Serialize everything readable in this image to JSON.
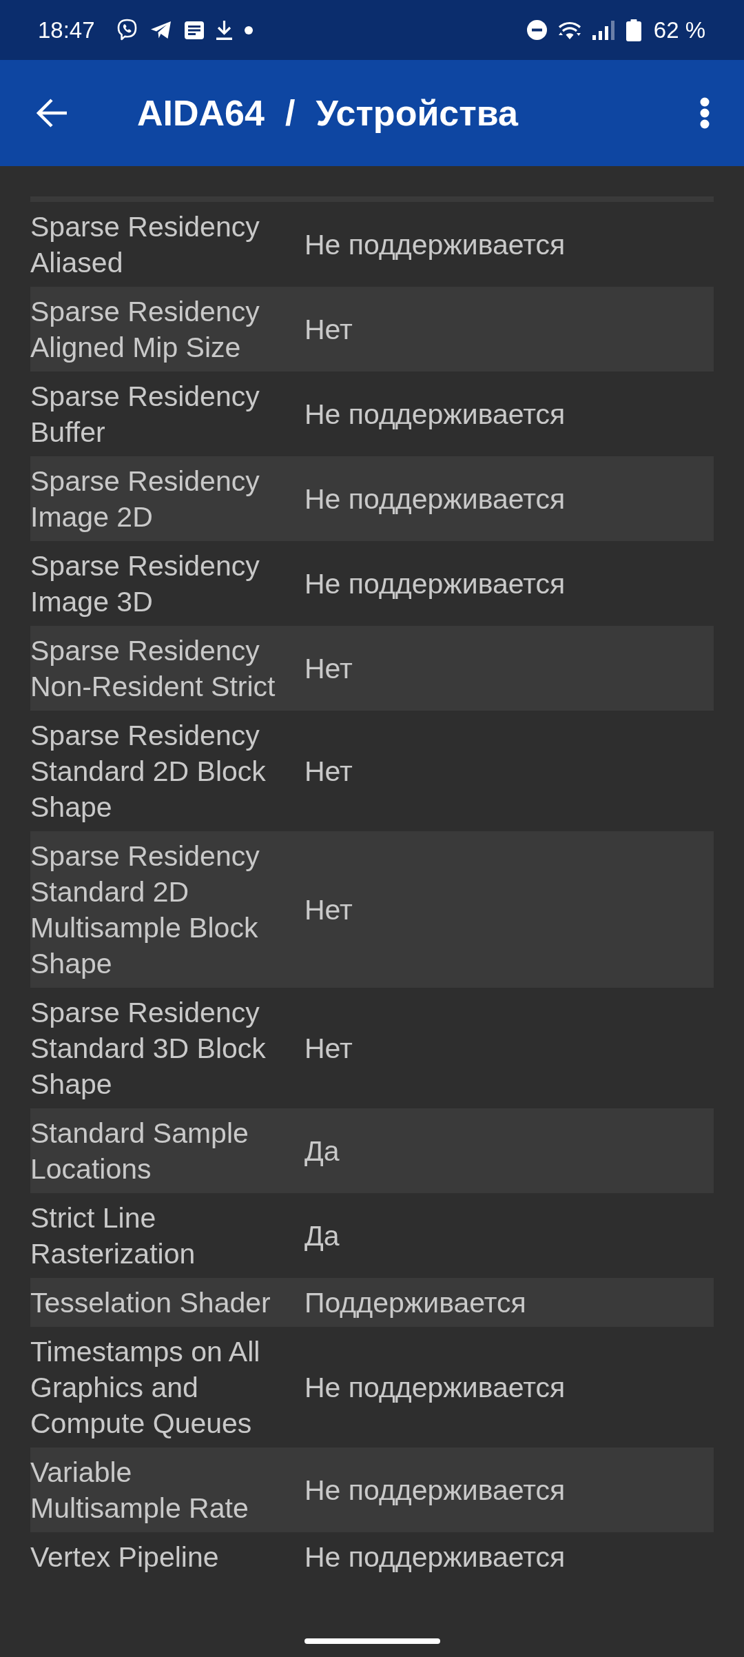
{
  "status_bar": {
    "time": "18:47",
    "battery": "62 %"
  },
  "app_bar": {
    "app": "AIDA64",
    "separator": "/",
    "section": "Устройства"
  },
  "rows": [
    {
      "label": "Sparse Residency Aliased",
      "value": "Не поддерживается"
    },
    {
      "label": "Sparse Residency Aligned Mip Size",
      "value": "Нет"
    },
    {
      "label": "Sparse Residency Buffer",
      "value": "Не поддерживается"
    },
    {
      "label": "Sparse Residency Image 2D",
      "value": "Не поддерживается"
    },
    {
      "label": "Sparse Residency Image 3D",
      "value": "Не поддерживается"
    },
    {
      "label": "Sparse Residency Non-Resident Strict",
      "value": "Нет"
    },
    {
      "label": "Sparse Residency Standard 2D Block Shape",
      "value": "Нет"
    },
    {
      "label": "Sparse Residency Standard 2D Multisample Block Shape",
      "value": "Нет"
    },
    {
      "label": "Sparse Residency Standard 3D Block Shape",
      "value": "Нет"
    },
    {
      "label": "Standard Sample Locations",
      "value": "Да"
    },
    {
      "label": "Strict Line Rasterization",
      "value": "Да"
    },
    {
      "label": "Tesselation Shader",
      "value": "Поддерживается"
    },
    {
      "label": "Timestamps on All Graphics and Compute Queues",
      "value": "Не поддерживается"
    },
    {
      "label": "Variable Multisample Rate",
      "value": "Не поддерживается"
    },
    {
      "label": "Vertex Pipeline",
      "value": "Не поддерживается"
    }
  ]
}
